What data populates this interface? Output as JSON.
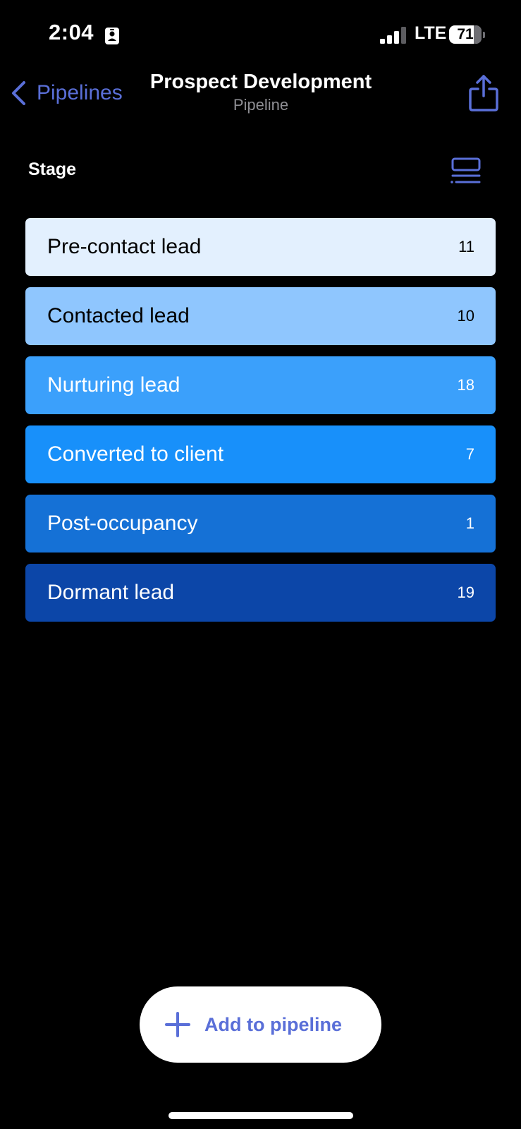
{
  "status_bar": {
    "time": "2:04",
    "network": "LTE",
    "battery_level": "71",
    "badge_icon": "id-badge-icon",
    "signal_icon": "cellular-signal-icon"
  },
  "nav": {
    "back_label": "Pipelines",
    "title": "Prospect Development",
    "subtitle": "Pipeline",
    "back_icon": "chevron-left-icon",
    "share_icon": "share-icon"
  },
  "section": {
    "header": "Stage",
    "toggle_icon": "list-view-icon"
  },
  "stages": [
    {
      "label": "Pre-contact lead",
      "count": "11",
      "color": "#e3f0fe",
      "text_color": "#000000"
    },
    {
      "label": "Contacted lead",
      "count": "10",
      "color": "#8fc6fe",
      "text_color": "#000000"
    },
    {
      "label": "Nurturing lead",
      "count": "18",
      "color": "#3ba0fb",
      "text_color": "#ffffff"
    },
    {
      "label": "Converted to client",
      "count": "7",
      "color": "#1890fa",
      "text_color": "#ffffff"
    },
    {
      "label": "Post-occupancy",
      "count": "1",
      "color": "#1571d6",
      "text_color": "#ffffff"
    },
    {
      "label": "Dormant lead",
      "count": "19",
      "color": "#0c46a8",
      "text_color": "#ffffff"
    }
  ],
  "add_button": {
    "label": "Add to pipeline",
    "icon": "plus-icon"
  },
  "colors": {
    "background": "#000000",
    "accent": "#5a6fd8",
    "subtitle": "#8e8e93"
  }
}
